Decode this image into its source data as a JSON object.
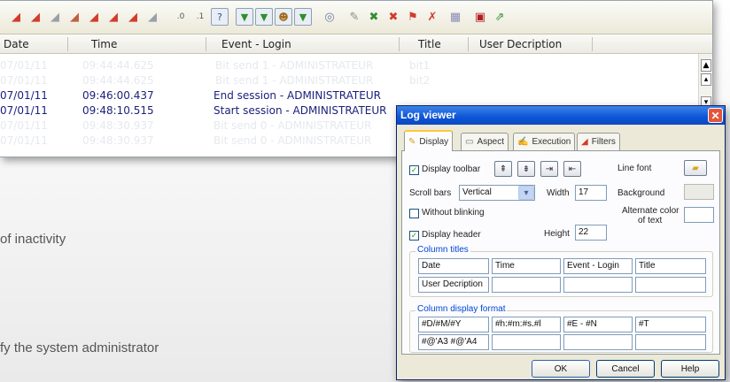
{
  "log_window": {
    "columns": [
      "Date",
      "Time",
      "Event - Login",
      "Title",
      "User Decription"
    ],
    "rows": [
      {
        "date": "07/01/11",
        "time": "09:44:44.625",
        "event": "Bit send 1 - ADMINISTRATEUR",
        "title": "bit1",
        "style": "ghost"
      },
      {
        "date": "07/01/11",
        "time": "09:44:44.625",
        "event": "Bit send 1 - ADMINISTRATEUR",
        "title": "bit2",
        "style": "ghost"
      },
      {
        "date": "07/01/11",
        "time": "09:46:00.437",
        "event": "End session - ADMINISTRATEUR",
        "title": "",
        "style": "real"
      },
      {
        "date": "07/01/11",
        "time": "09:48:10.515",
        "event": "Start session - ADMINISTRATEUR",
        "title": "",
        "style": "real"
      },
      {
        "date": "07/01/11",
        "time": "09:48:30.937",
        "event": "Bit send 0 - ADMINISTRATEUR",
        "title": "",
        "style": "ghost"
      },
      {
        "date": "07/01/11",
        "time": "09:48:30.937",
        "event": "Bit send 0 - ADMINISTRATEUR",
        "title": "",
        "style": "ghost"
      }
    ],
    "toolbar_icons": [
      "eraser-red-icon",
      "eraser-red-icon",
      "eraser-gray-icon",
      "eraser-mixed-icon",
      "eraser-red-icon",
      "eraser-red-icon",
      "eraser-red-icon",
      "eraser-gray-icon",
      "zero-zero-icon",
      "one-zero-icon",
      "help-icon",
      "filter-icon",
      "filter-date-icon",
      "filter-user-icon",
      "filter-all-icon",
      "target-icon",
      "settings-icon",
      "cross-icon",
      "cross-icon",
      "flag-icon",
      "eraser-icon",
      "grid-icon",
      "excel-icon",
      "export-icon"
    ]
  },
  "body_text": {
    "line1": "of inactivity",
    "line2": "fy the system administrator"
  },
  "dialog": {
    "title": "Log viewer",
    "tabs": [
      "Display",
      "Aspect",
      "Execution",
      "Filters"
    ],
    "display_toolbar_label": "Display toolbar",
    "line_font_label": "Line font",
    "scroll_bars_label": "Scroll bars",
    "scroll_bars_value": "Vertical",
    "width_label": "Width",
    "width_value": "17",
    "background_label": "Background",
    "without_blinking_label": "Without blinking",
    "alternate_color_label_1": "Alternate color",
    "alternate_color_label_2": "of text",
    "display_header_label": "Display header",
    "height_label": "Height",
    "height_value": "22",
    "column_titles_label": "Column titles",
    "column_titles": [
      "Date",
      "Time",
      "Event - Login",
      "Title",
      "User Decription",
      "",
      "",
      ""
    ],
    "column_format_label": "Column display format",
    "column_formats": [
      "#D/#M/#Y",
      "#h:#m:#s.#l",
      "#E - #N",
      "#T",
      "#@'A3 #@'A4",
      "",
      "",
      ""
    ],
    "ok": "OK",
    "cancel": "Cancel",
    "help": "Help",
    "display_toolbar_checked": true,
    "without_blinking_checked": false,
    "display_header_checked": true,
    "title_bar_color": "#0d55d6",
    "tab_highlight_color": "#ffc83c"
  }
}
